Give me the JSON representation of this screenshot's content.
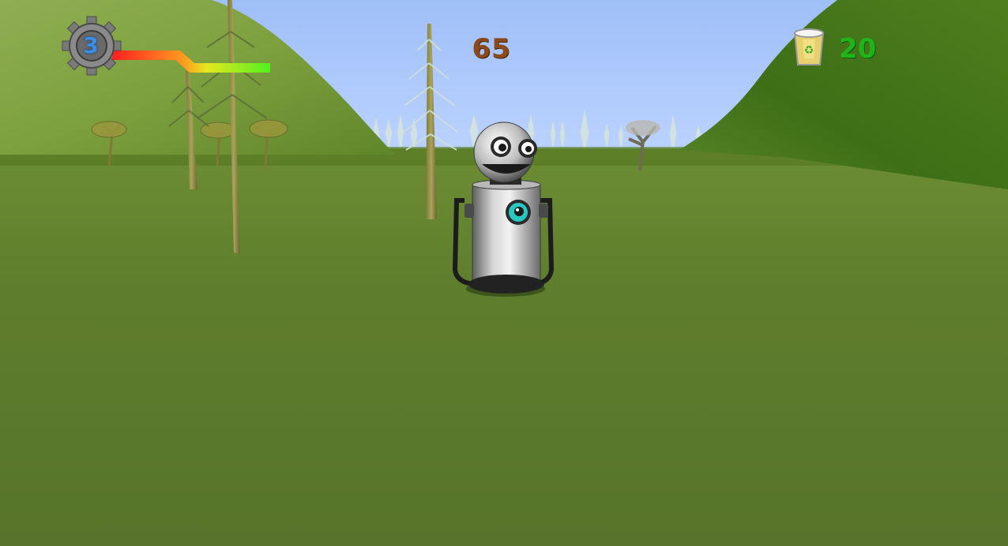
{
  "hud": {
    "lives": "3",
    "score": "65",
    "trash_count": "20",
    "health_fraction": 0.62,
    "icons": {
      "lives": "gear-icon",
      "trash": "recycle-bin-icon"
    }
  },
  "colors": {
    "sky": "#a7c6ff",
    "grass": "#5d7a2c",
    "hill": "#6f9a2e",
    "score": "#8a4a1c",
    "trash_count": "#1fb519",
    "lives": "#3a8ee6",
    "health_low": "#ff1f1f",
    "health_high": "#7aff1f"
  }
}
